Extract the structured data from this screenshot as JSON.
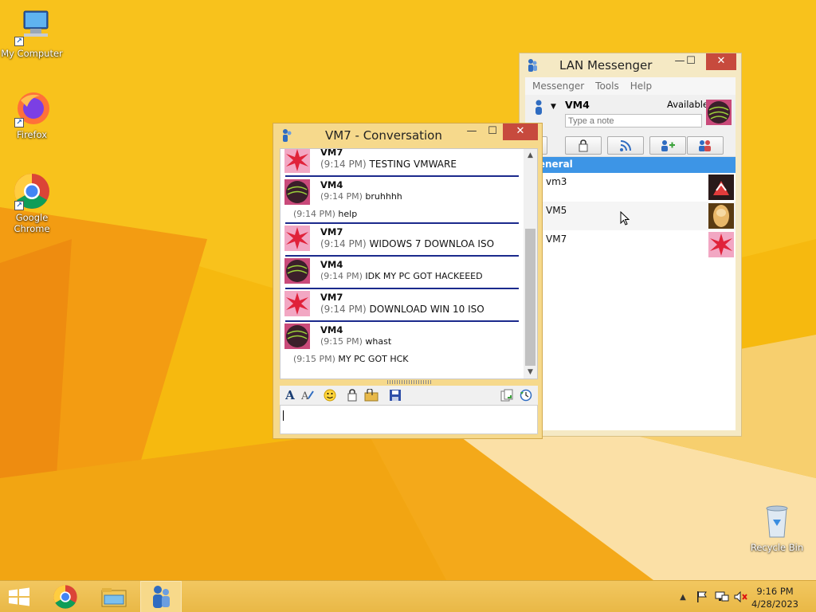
{
  "desktop": {
    "icons": [
      {
        "label": "My Computer"
      },
      {
        "label": "Firefox"
      },
      {
        "label": "Google Chrome"
      },
      {
        "label": "Recycle Bin"
      }
    ]
  },
  "lan_messenger": {
    "title": "LAN Messenger",
    "controls": {
      "minimize": "—",
      "maximize": "☐",
      "close": "✕"
    },
    "menu": [
      "Messenger",
      "Tools",
      "Help"
    ],
    "profile": {
      "name": "VM4",
      "status": "Available",
      "note_placeholder": "Type a note"
    },
    "group": "General",
    "users": [
      {
        "name": "vm3"
      },
      {
        "name": "VM5"
      },
      {
        "name": "VM7"
      }
    ]
  },
  "conversation": {
    "title": "VM7 - Conversation",
    "controls": {
      "minimize": "—",
      "maximize": "☐",
      "close": "✕"
    },
    "messages": [
      {
        "sender": "VM7",
        "lines": [
          {
            "time": "(9:14 PM)",
            "text": " TESTING VMWARE"
          }
        ]
      },
      {
        "sender": "VM4",
        "lines": [
          {
            "time": "(9:14 PM)",
            "text": " bruhhhh"
          },
          {
            "time": "(9:14 PM)",
            "text": " help"
          }
        ]
      },
      {
        "sender": "VM7",
        "lines": [
          {
            "time": "(9:14 PM)",
            "text": " WIDOWS 7 DOWNLOA ISO"
          }
        ]
      },
      {
        "sender": "VM4",
        "lines": [
          {
            "time": "(9:14 PM)",
            "text": " IDK MY PC GOT HACKEEED"
          }
        ]
      },
      {
        "sender": "VM7",
        "lines": [
          {
            "time": "(9:14 PM)",
            "text": " DOWNLOAD WIN 10 ISO"
          }
        ]
      },
      {
        "sender": "VM4",
        "lines": [
          {
            "time": "(9:15 PM)",
            "text": " whast"
          },
          {
            "time": "(9:15 PM)",
            "text": " MY PC GOT HCK"
          }
        ]
      }
    ],
    "input_value": ""
  },
  "taskbar": {
    "clock_time": "9:16 PM",
    "clock_date": "4/28/2023"
  },
  "colors": {
    "wallpaper": "#f4b400",
    "separator": "#1b2a8c",
    "group_header": "#3d95e6",
    "close_button": "#c74a3d"
  }
}
